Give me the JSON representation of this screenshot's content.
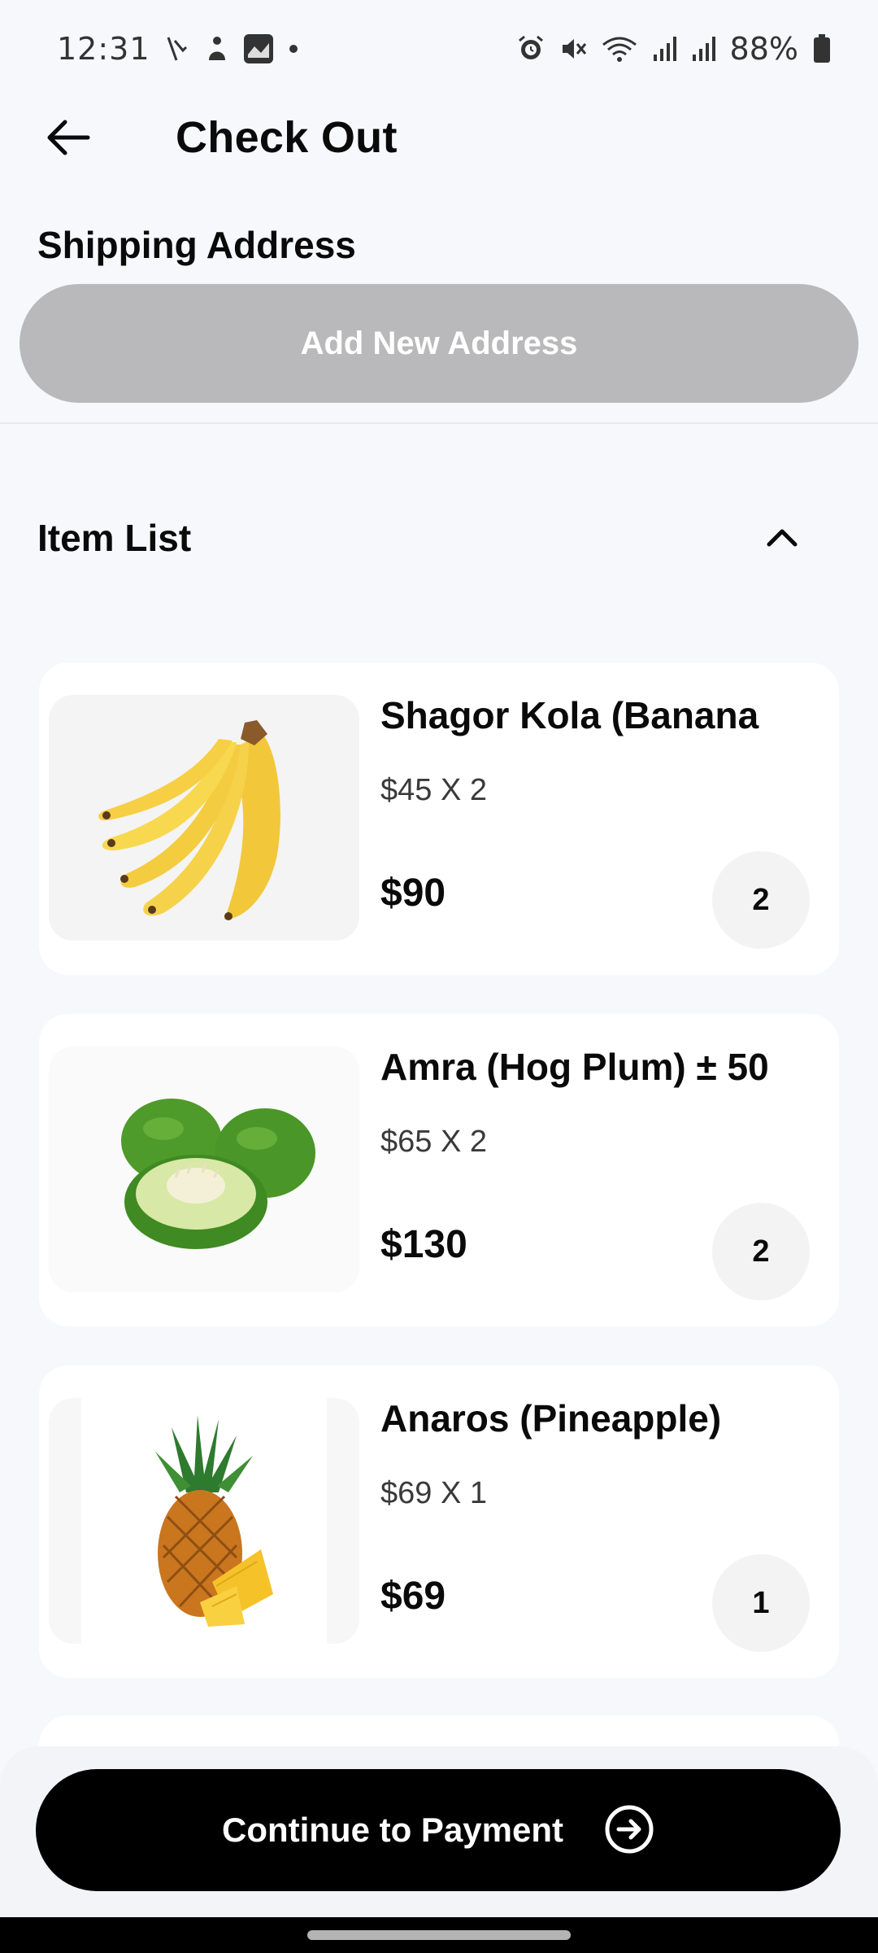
{
  "status_bar": {
    "time": "12:31",
    "battery_percent": "88%",
    "icons_left": [
      "scribble-icon",
      "person-notification-icon",
      "app-notification-icon",
      "dot-icon"
    ],
    "icons_right": [
      "alarm-icon",
      "mute-icon",
      "wifi-icon",
      "signal-icon",
      "signal-icon",
      "battery-icon"
    ]
  },
  "header": {
    "title": "Check Out",
    "back_icon": "arrow-left-icon"
  },
  "shipping": {
    "title": "Shipping Address",
    "add_button_label": "Add New Address"
  },
  "items_section": {
    "title": "Item List",
    "toggle_icon": "chevron-up-icon"
  },
  "items": [
    {
      "name": "Shagor Kola (Banana",
      "unit_price": "$45 X 2",
      "total": "$90",
      "quantity": "2",
      "image_icon": "banana-image"
    },
    {
      "name": "Amra (Hog Plum) ± 50",
      "unit_price": "$65 X 2",
      "total": "$130",
      "quantity": "2",
      "image_icon": "hog-plum-image"
    },
    {
      "name": "Anaros (Pineapple)",
      "unit_price": "$69 X 1",
      "total": "$69",
      "quantity": "1",
      "image_icon": "pineapple-image"
    }
  ],
  "footer": {
    "continue_label": "Continue to Payment",
    "continue_icon": "arrow-right-circle-icon"
  },
  "colors": {
    "background": "#f6f8fb",
    "primary_button": "#000000",
    "disabled_button": "#b9b9bb"
  }
}
